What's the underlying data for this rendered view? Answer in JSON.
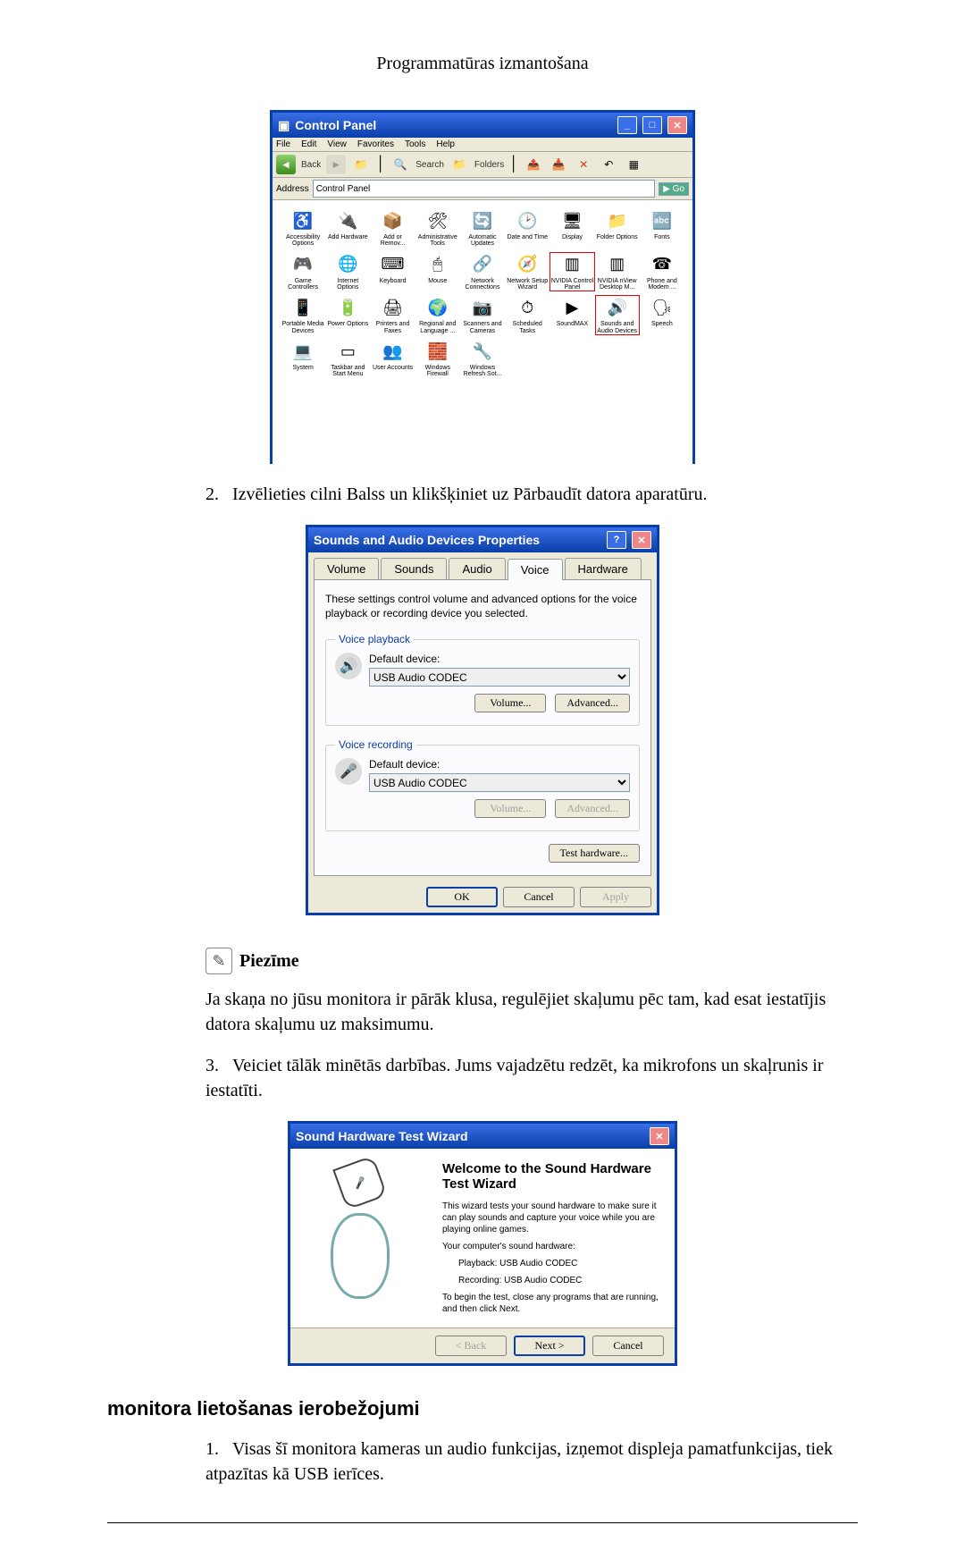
{
  "page": {
    "header": "Programmatūras izmantošana",
    "section_heading": "monitora lietošanas ierobežojumi"
  },
  "steps": {
    "s2_num": "2.",
    "s2": "Izvēlieties cilni Balss un klikšķiniet uz Pārbaudīt datora aparatūru.",
    "s3_num": "3.",
    "s3": "Veiciet tālāk minētās darbības. Jums vajadzētu redzēt, ka mikrofons un skaļrunis ir iestatīti.",
    "sub1_num": "1.",
    "sub1": "Visas šī monitora kameras un audio funkcijas, izņemot displeja pamatfunkcijas, tiek atpazītas kā USB ierīces."
  },
  "note": {
    "label": "Piezīme",
    "text": "Ja skaņa no jūsu monitora ir pārāk klusa, regulējiet skaļumu pēc tam, kad esat iestatījis datora skaļumu uz maksimumu."
  },
  "cpanel": {
    "title": "Control Panel",
    "menus": [
      "File",
      "Edit",
      "View",
      "Favorites",
      "Tools",
      "Help"
    ],
    "back": "Back",
    "search": "Search",
    "folders": "Folders",
    "address_label": "Address",
    "address_value": "Control Panel",
    "go": "Go",
    "items": [
      {
        "label": "Accessibility Options",
        "ico": "♿"
      },
      {
        "label": "Add Hardware",
        "ico": "🔌"
      },
      {
        "label": "Add or Remov...",
        "ico": "📦"
      },
      {
        "label": "Administrative Tools",
        "ico": "🛠"
      },
      {
        "label": "Automatic Updates",
        "ico": "🔄"
      },
      {
        "label": "Date and Time",
        "ico": "🕑"
      },
      {
        "label": "Display",
        "ico": "🖥"
      },
      {
        "label": "Folder Options",
        "ico": "📁"
      },
      {
        "label": "Fonts",
        "ico": "🔤"
      },
      {
        "label": "Game Controllers",
        "ico": "🎮"
      },
      {
        "label": "Internet Options",
        "ico": "🌐"
      },
      {
        "label": "Keyboard",
        "ico": "⌨"
      },
      {
        "label": "Mouse",
        "ico": "🖱"
      },
      {
        "label": "Network Connections",
        "ico": "🔗"
      },
      {
        "label": "Network Setup Wizard",
        "ico": "🧭"
      },
      {
        "label": "NVIDIA Control Panel",
        "ico": "▥",
        "hl": true
      },
      {
        "label": "NVIDIA nView Desktop M...",
        "ico": "▥"
      },
      {
        "label": "Phone and Modem ...",
        "ico": "☎"
      },
      {
        "label": "Portable Media Devices",
        "ico": "📱"
      },
      {
        "label": "Power Options",
        "ico": "🔋"
      },
      {
        "label": "Printers and Faxes",
        "ico": "🖨"
      },
      {
        "label": "Regional and Language ...",
        "ico": "🌍"
      },
      {
        "label": "Scanners and Cameras",
        "ico": "📷"
      },
      {
        "label": "Scheduled Tasks",
        "ico": "⏱"
      },
      {
        "label": "SoundMAX",
        "ico": "▶"
      },
      {
        "label": "Sounds and Audio Devices",
        "ico": "🔊",
        "hl": true
      },
      {
        "label": "Speech",
        "ico": "🗣"
      },
      {
        "label": "System",
        "ico": "💻"
      },
      {
        "label": "Taskbar and Start Menu",
        "ico": "▭"
      },
      {
        "label": "User Accounts",
        "ico": "👥"
      },
      {
        "label": "Windows Firewall",
        "ico": "🧱"
      },
      {
        "label": "Windows Refresh Sot...",
        "ico": "🔧"
      }
    ]
  },
  "props": {
    "title": "Sounds and Audio Devices Properties",
    "tabs": {
      "volume": "Volume",
      "sounds": "Sounds",
      "audio": "Audio",
      "voice": "Voice",
      "hardware": "Hardware"
    },
    "desc": "These settings control volume and advanced options for the voice playback or recording device you selected.",
    "playback_legend": "Voice playback",
    "recording_legend": "Voice recording",
    "default_device": "Default device:",
    "device_value": "USB Audio CODEC",
    "btn_volume": "Volume...",
    "btn_advanced": "Advanced...",
    "btn_test": "Test hardware...",
    "btn_ok": "OK",
    "btn_cancel": "Cancel",
    "btn_apply": "Apply"
  },
  "wizard": {
    "title": "Sound Hardware Test Wizard",
    "heading": "Welcome to the Sound Hardware Test Wizard",
    "p1": "This wizard tests your sound hardware to make sure it can play sounds and capture your voice while you are playing online games.",
    "p2": "Your computer's sound hardware:",
    "playback": "Playback: USB Audio CODEC",
    "recording": "Recording: USB Audio CODEC",
    "p3": "To begin the test, close any programs that are running, and then click Next.",
    "btn_back": "< Back",
    "btn_next": "Next >",
    "btn_cancel": "Cancel"
  }
}
